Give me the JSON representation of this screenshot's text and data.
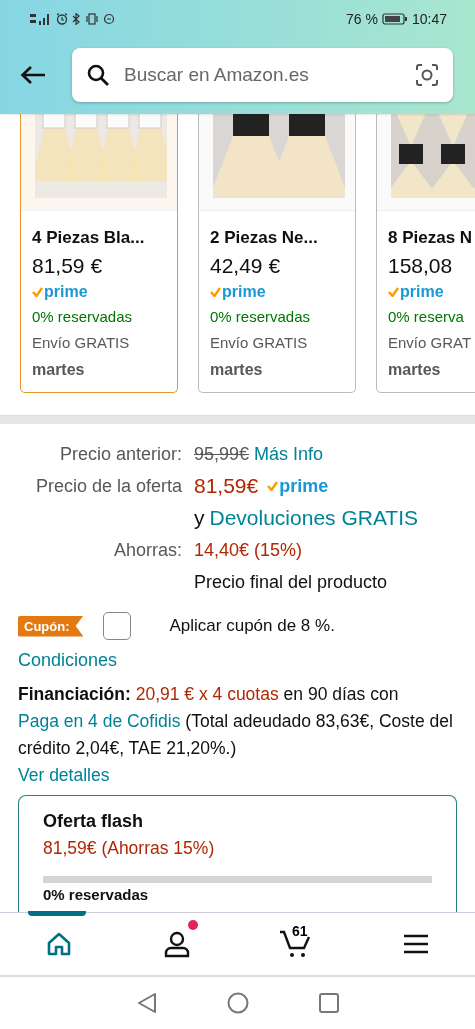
{
  "status_bar": {
    "battery": "76 %",
    "time": "10:47"
  },
  "search": {
    "placeholder": "Buscar en Amazon.es"
  },
  "products": [
    {
      "title": "4 Piezas Bla...",
      "price": "81,59 €",
      "badge": "prime",
      "claimed": "0% reservadas",
      "shipping": "Envío GRATIS",
      "delivery": "martes",
      "selected": true
    },
    {
      "title": "2 Piezas Ne...",
      "price": "42,49 €",
      "badge": "prime",
      "claimed": "0% reservadas",
      "shipping": "Envío GRATIS",
      "delivery": "martes",
      "selected": false
    },
    {
      "title": "8 Piezas N",
      "price": "158,08",
      "badge": "prime",
      "claimed": "0% reserva",
      "shipping": "Envío GRAT",
      "delivery": "martes",
      "selected": false
    }
  ],
  "price": {
    "previous_label": "Precio anterior:",
    "previous_price": "95,99€",
    "more_info": "Más Info",
    "deal_label": "Precio de la oferta",
    "deal_price": "81,59€",
    "deal_badge": "prime",
    "returns_prefix": "y",
    "returns_link": "Devoluciones GRATIS",
    "savings_label": "Ahorras:",
    "savings": "14,40€ (15%)",
    "final_note": "Precio final del producto"
  },
  "coupon": {
    "tag": "Cupón:",
    "checked": false,
    "label": "Aplicar cupón de 8 %.",
    "conditions": "Condiciones"
  },
  "financing": {
    "label": "Financiación:",
    "amount": "20,91 € x 4 cuotas",
    "middle": "en 90 días con",
    "link": "Paga en 4 de Cofidis",
    "rest": "(Total adeudado 83,63€, Coste del crédito 2,04€, TAE 21,20%.)",
    "details": "Ver detalles"
  },
  "flash_deal": {
    "title": "Oferta flash",
    "price": "81,59€ (Ahorras 15%)",
    "level": 0,
    "claimed": "0% reservadas"
  },
  "bottom_nav": [
    {
      "kind": "home",
      "selected": true
    },
    {
      "kind": "account",
      "selected": false,
      "notification": true
    },
    {
      "kind": "cart",
      "selected": false,
      "count": "61"
    },
    {
      "kind": "menu",
      "selected": false
    }
  ]
}
